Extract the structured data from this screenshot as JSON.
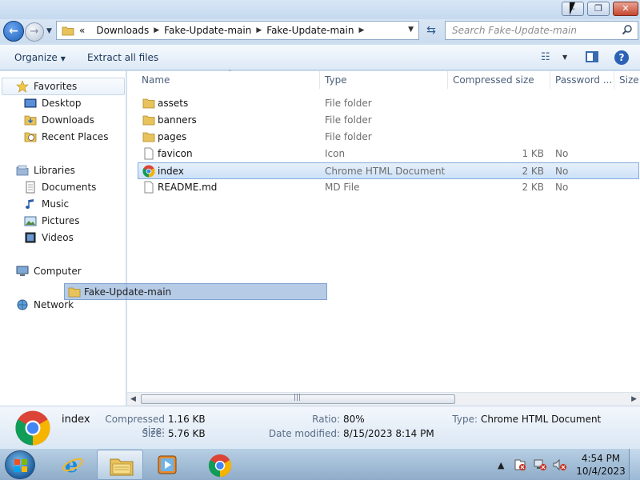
{
  "window": {
    "min_label": "–",
    "max_label": "❐",
    "close_label": "✕"
  },
  "nav": {
    "back_label": "←",
    "forward_label": "→"
  },
  "address": {
    "overflow": "«",
    "crumbs": [
      "Downloads",
      "Fake-Update-main",
      "Fake-Update-main"
    ]
  },
  "search": {
    "placeholder": "Search Fake-Update-main"
  },
  "toolbar": {
    "organize": "Organize",
    "extract": "Extract all files"
  },
  "navpane": {
    "favorites": "Favorites",
    "desktop": "Desktop",
    "downloads": "Downloads",
    "recent": "Recent Places",
    "libraries": "Libraries",
    "documents": "Documents",
    "music": "Music",
    "pictures": "Pictures",
    "videos": "Videos",
    "computer": "Computer",
    "network": "Network"
  },
  "columns": {
    "name": "Name",
    "type": "Type",
    "compressed": "Compressed size",
    "password": "Password ...",
    "size": "Size"
  },
  "files": [
    {
      "name": "assets",
      "type": "File folder",
      "size": "",
      "pw": "",
      "icon": "folder-icon"
    },
    {
      "name": "banners",
      "type": "File folder",
      "size": "",
      "pw": "",
      "icon": "folder-icon"
    },
    {
      "name": "pages",
      "type": "File folder",
      "size": "",
      "pw": "",
      "icon": "folder-icon"
    },
    {
      "name": "favicon",
      "type": "Icon",
      "size": "1 KB",
      "pw": "No",
      "icon": "file-icon"
    },
    {
      "name": "index",
      "type": "Chrome HTML Document",
      "size": "2 KB",
      "pw": "No",
      "icon": "chrome-icon",
      "selected": true
    },
    {
      "name": "README.md",
      "type": "MD File",
      "size": "2 KB",
      "pw": "No",
      "icon": "file-icon"
    }
  ],
  "drag": {
    "label": "Fake-Update-main"
  },
  "details": {
    "name": "index",
    "compressed_label": "Compressed size:",
    "compressed_value": "1.16 KB",
    "size_label": "Size:",
    "size_value": "5.76 KB",
    "ratio_label": "Ratio:",
    "ratio_value": "80%",
    "modified_label": "Date modified:",
    "modified_value": "8/15/2023 8:14 PM",
    "type_label": "Type:",
    "type_value": "Chrome HTML Document"
  },
  "taskbar": {
    "time": "4:54 PM",
    "date": "10/4/2023"
  }
}
